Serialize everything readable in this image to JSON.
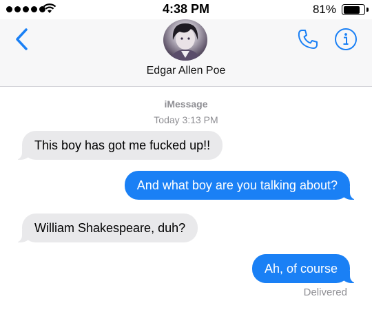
{
  "status_bar": {
    "time": "4:38 PM",
    "battery_percent": "81%",
    "battery_level": 0.81,
    "signal_bars": 5,
    "wifi_icon": "wifi-icon"
  },
  "header": {
    "back_icon": "chevron-left-icon",
    "contact_name": "Edgar Allen Poe",
    "phone_icon": "phone-icon",
    "info_icon": "info-icon"
  },
  "thread": {
    "service": "iMessage",
    "timestamp": "Today 3:13 PM",
    "messages": [
      {
        "direction": "incoming",
        "text": "This boy has got me fucked up!!"
      },
      {
        "direction": "outgoing",
        "text": "And what boy are you talking about?"
      },
      {
        "direction": "incoming",
        "text": "William Shakespeare, duh?"
      },
      {
        "direction": "outgoing",
        "text": "Ah, of course"
      }
    ],
    "receipt": "Delivered"
  },
  "colors": {
    "accent": "#1a80f5",
    "incoming_bubble": "#e9e9eb",
    "meta_gray": "#8e8e93"
  }
}
